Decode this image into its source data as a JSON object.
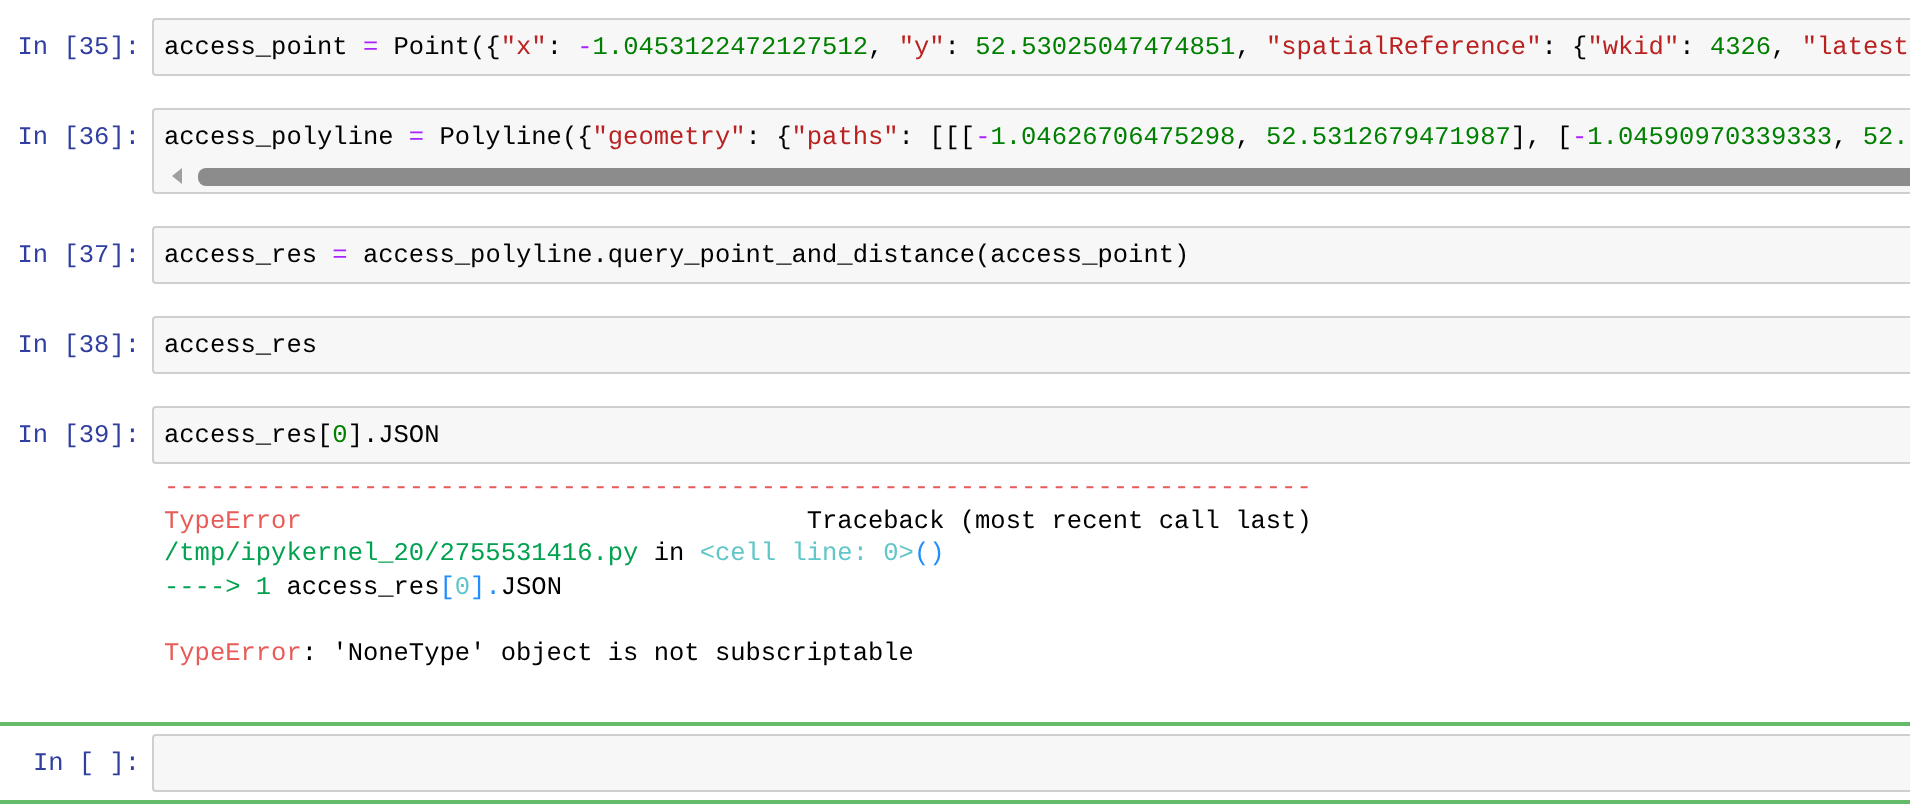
{
  "cells": [
    {
      "prompt": "In [35]:",
      "selected": false,
      "scrollbar": false,
      "code": [
        {
          "text": "access_point ",
          "kind": "name"
        },
        {
          "text": "=",
          "kind": "op"
        },
        {
          "text": " Point({",
          "kind": "name"
        },
        {
          "text": "\"x\"",
          "kind": "str"
        },
        {
          "text": ": ",
          "kind": "plain"
        },
        {
          "text": "-",
          "kind": "op"
        },
        {
          "text": "1.0453122472127512",
          "kind": "num"
        },
        {
          "text": ", ",
          "kind": "plain"
        },
        {
          "text": "\"y\"",
          "kind": "str"
        },
        {
          "text": ": ",
          "kind": "plain"
        },
        {
          "text": "52.53025047474851",
          "kind": "num"
        },
        {
          "text": ", ",
          "kind": "plain"
        },
        {
          "text": "\"spatialReference\"",
          "kind": "str"
        },
        {
          "text": ": {",
          "kind": "plain"
        },
        {
          "text": "\"wkid\"",
          "kind": "str"
        },
        {
          "text": ": ",
          "kind": "plain"
        },
        {
          "text": "4326",
          "kind": "num"
        },
        {
          "text": ", ",
          "kind": "plain"
        },
        {
          "text": "\"latest",
          "kind": "str"
        }
      ]
    },
    {
      "prompt": "In [36]:",
      "selected": false,
      "scrollbar": true,
      "code": [
        {
          "text": "access_polyline ",
          "kind": "name"
        },
        {
          "text": "=",
          "kind": "op"
        },
        {
          "text": " Polyline({",
          "kind": "name"
        },
        {
          "text": "\"geometry\"",
          "kind": "str"
        },
        {
          "text": ": {",
          "kind": "plain"
        },
        {
          "text": "\"paths\"",
          "kind": "str"
        },
        {
          "text": ": [[[",
          "kind": "plain"
        },
        {
          "text": "-",
          "kind": "op"
        },
        {
          "text": "1.04626706475298",
          "kind": "num"
        },
        {
          "text": ", ",
          "kind": "plain"
        },
        {
          "text": "52.5312679471987",
          "kind": "num"
        },
        {
          "text": "], [",
          "kind": "plain"
        },
        {
          "text": "-",
          "kind": "op"
        },
        {
          "text": "1.04590970339333",
          "kind": "num"
        },
        {
          "text": ", ",
          "kind": "plain"
        },
        {
          "text": "52.",
          "kind": "num"
        }
      ]
    },
    {
      "prompt": "In [37]:",
      "selected": false,
      "scrollbar": false,
      "code": [
        {
          "text": "access_res ",
          "kind": "name"
        },
        {
          "text": "=",
          "kind": "op"
        },
        {
          "text": " access_polyline.query_point_and_distance(access_point)",
          "kind": "name"
        }
      ]
    },
    {
      "prompt": "In [38]:",
      "selected": false,
      "scrollbar": false,
      "code": [
        {
          "text": "access_res",
          "kind": "name"
        }
      ]
    },
    {
      "prompt": "In [39]:",
      "selected": false,
      "scrollbar": false,
      "code": [
        {
          "text": "access_res[",
          "kind": "name"
        },
        {
          "text": "0",
          "kind": "num"
        },
        {
          "text": "].JSON",
          "kind": "name"
        }
      ],
      "output": [
        {
          "after_blank": false,
          "tokens": [
            {
              "text": "---------------------------------------------------------------------------",
              "kind": "err"
            }
          ]
        },
        {
          "after_blank": false,
          "tokens": [
            {
              "text": "TypeError",
              "kind": "err"
            },
            {
              "text": "                                 Traceback (most recent call last)",
              "kind": "plain"
            }
          ]
        },
        {
          "after_blank": false,
          "tokens": [
            {
              "text": "/tmp/ipykernel_20/2755531416.py",
              "kind": "path"
            },
            {
              "text": " in ",
              "kind": "plain"
            },
            {
              "text": "<cell line: 0>",
              "kind": "cyan"
            },
            {
              "text": "()",
              "kind": "blue"
            }
          ]
        },
        {
          "after_blank": false,
          "tokens": [
            {
              "text": "----> 1 ",
              "kind": "path"
            },
            {
              "text": "access_res",
              "kind": "plain"
            },
            {
              "text": "[",
              "kind": "blue"
            },
            {
              "text": "0",
              "kind": "cyan"
            },
            {
              "text": "].",
              "kind": "blue"
            },
            {
              "text": "JSON",
              "kind": "plain"
            }
          ]
        },
        {
          "after_blank": true,
          "tokens": [
            {
              "text": "TypeError",
              "kind": "err"
            },
            {
              "text": ": 'NoneType' object is not subscriptable",
              "kind": "plain"
            }
          ]
        }
      ]
    },
    {
      "prompt": "In [ ]:",
      "selected": true,
      "scrollbar": false
    }
  ]
}
